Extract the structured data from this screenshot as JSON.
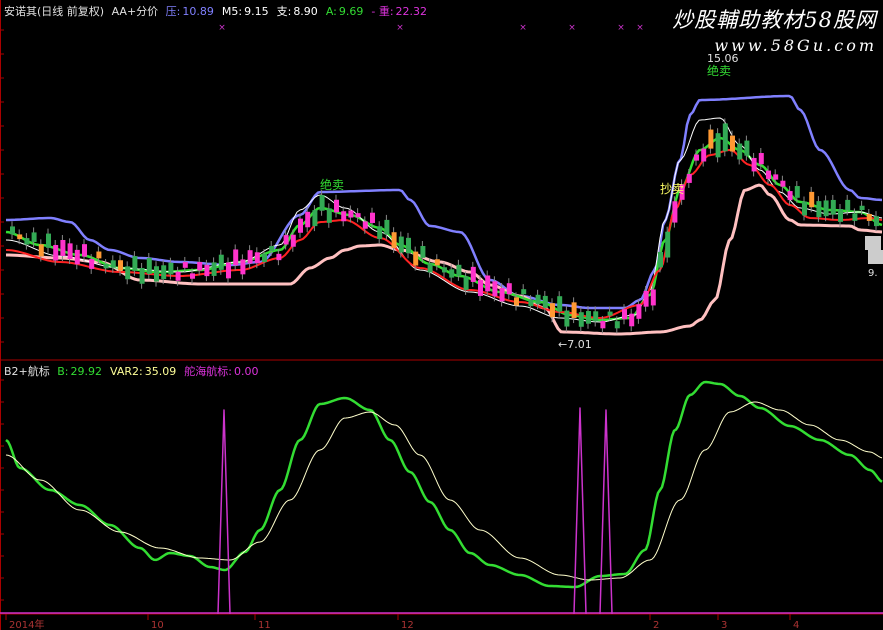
{
  "main_header": {
    "title": "安诺其(日线 前复权)",
    "indicator": "AA+分价",
    "items": [
      {
        "label": "压:",
        "value": "10.89",
        "color": "#8080ff"
      },
      {
        "label": "M5:",
        "value": "9.15",
        "color": "#ffffff"
      },
      {
        "label": "支:",
        "value": "8.90",
        "color": "#ffffff"
      },
      {
        "label": "A:",
        "value": "9.69",
        "color": "#33dd33"
      },
      {
        "label": "- 重:",
        "value": "22.32",
        "color": "#dd33dd"
      }
    ]
  },
  "sub_header": {
    "title": "B2+航标",
    "items": [
      {
        "label": "B:",
        "value": "29.92",
        "color": "#33dd33"
      },
      {
        "label": "VAR2:",
        "value": "35.09",
        "color": "#ffff99"
      },
      {
        "label": "舵海航标:",
        "value": "0.00",
        "color": "#dd33dd"
      }
    ]
  },
  "watermark": {
    "line1": "炒股輔助教材58股网",
    "line2": "www.58Gu.com"
  },
  "signals": [
    {
      "text": "绝卖",
      "color": "#33dd33"
    },
    {
      "text": "绝卖",
      "color": "#33dd33"
    },
    {
      "text": "抄卖",
      "color": "#ffff66"
    }
  ],
  "price_labels": {
    "high": "15.06",
    "low": "←7.01",
    "right_edge": "9."
  },
  "bottom_axis": [
    "2014年",
    "10",
    "11",
    "12",
    "2",
    "3",
    "4"
  ],
  "colors": {
    "background": "#000000",
    "resistance": "#8080ff",
    "support": "#ffc0c0",
    "green_line": "#33dd33",
    "red_line": "#ff2222",
    "white_line": "#ffffcc",
    "up_candle": "#ff33cc",
    "down_candle": "#33aa55",
    "spike": "#cc33cc",
    "axis": "#aa0000"
  }
}
